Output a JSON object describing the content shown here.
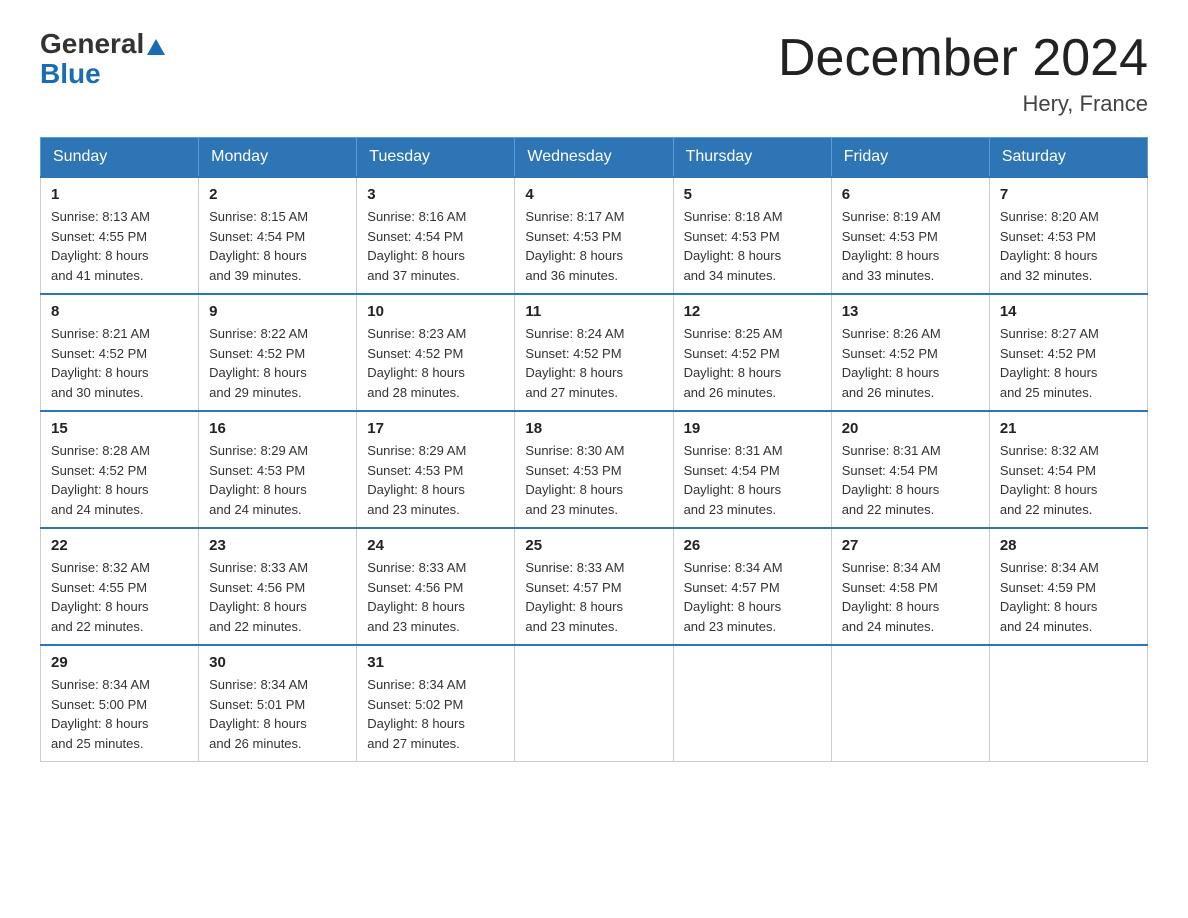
{
  "header": {
    "logo_line1": "General",
    "logo_line2": "Blue",
    "month_title": "December 2024",
    "location": "Hery, France"
  },
  "weekdays": [
    "Sunday",
    "Monday",
    "Tuesday",
    "Wednesday",
    "Thursday",
    "Friday",
    "Saturday"
  ],
  "weeks": [
    [
      {
        "day": "1",
        "sunrise": "8:13 AM",
        "sunset": "4:55 PM",
        "daylight": "8 hours and 41 minutes."
      },
      {
        "day": "2",
        "sunrise": "8:15 AM",
        "sunset": "4:54 PM",
        "daylight": "8 hours and 39 minutes."
      },
      {
        "day": "3",
        "sunrise": "8:16 AM",
        "sunset": "4:54 PM",
        "daylight": "8 hours and 37 minutes."
      },
      {
        "day": "4",
        "sunrise": "8:17 AM",
        "sunset": "4:53 PM",
        "daylight": "8 hours and 36 minutes."
      },
      {
        "day": "5",
        "sunrise": "8:18 AM",
        "sunset": "4:53 PM",
        "daylight": "8 hours and 34 minutes."
      },
      {
        "day": "6",
        "sunrise": "8:19 AM",
        "sunset": "4:53 PM",
        "daylight": "8 hours and 33 minutes."
      },
      {
        "day": "7",
        "sunrise": "8:20 AM",
        "sunset": "4:53 PM",
        "daylight": "8 hours and 32 minutes."
      }
    ],
    [
      {
        "day": "8",
        "sunrise": "8:21 AM",
        "sunset": "4:52 PM",
        "daylight": "8 hours and 30 minutes."
      },
      {
        "day": "9",
        "sunrise": "8:22 AM",
        "sunset": "4:52 PM",
        "daylight": "8 hours and 29 minutes."
      },
      {
        "day": "10",
        "sunrise": "8:23 AM",
        "sunset": "4:52 PM",
        "daylight": "8 hours and 28 minutes."
      },
      {
        "day": "11",
        "sunrise": "8:24 AM",
        "sunset": "4:52 PM",
        "daylight": "8 hours and 27 minutes."
      },
      {
        "day": "12",
        "sunrise": "8:25 AM",
        "sunset": "4:52 PM",
        "daylight": "8 hours and 26 minutes."
      },
      {
        "day": "13",
        "sunrise": "8:26 AM",
        "sunset": "4:52 PM",
        "daylight": "8 hours and 26 minutes."
      },
      {
        "day": "14",
        "sunrise": "8:27 AM",
        "sunset": "4:52 PM",
        "daylight": "8 hours and 25 minutes."
      }
    ],
    [
      {
        "day": "15",
        "sunrise": "8:28 AM",
        "sunset": "4:52 PM",
        "daylight": "8 hours and 24 minutes."
      },
      {
        "day": "16",
        "sunrise": "8:29 AM",
        "sunset": "4:53 PM",
        "daylight": "8 hours and 24 minutes."
      },
      {
        "day": "17",
        "sunrise": "8:29 AM",
        "sunset": "4:53 PM",
        "daylight": "8 hours and 23 minutes."
      },
      {
        "day": "18",
        "sunrise": "8:30 AM",
        "sunset": "4:53 PM",
        "daylight": "8 hours and 23 minutes."
      },
      {
        "day": "19",
        "sunrise": "8:31 AM",
        "sunset": "4:54 PM",
        "daylight": "8 hours and 23 minutes."
      },
      {
        "day": "20",
        "sunrise": "8:31 AM",
        "sunset": "4:54 PM",
        "daylight": "8 hours and 22 minutes."
      },
      {
        "day": "21",
        "sunrise": "8:32 AM",
        "sunset": "4:54 PM",
        "daylight": "8 hours and 22 minutes."
      }
    ],
    [
      {
        "day": "22",
        "sunrise": "8:32 AM",
        "sunset": "4:55 PM",
        "daylight": "8 hours and 22 minutes."
      },
      {
        "day": "23",
        "sunrise": "8:33 AM",
        "sunset": "4:56 PM",
        "daylight": "8 hours and 22 minutes."
      },
      {
        "day": "24",
        "sunrise": "8:33 AM",
        "sunset": "4:56 PM",
        "daylight": "8 hours and 23 minutes."
      },
      {
        "day": "25",
        "sunrise": "8:33 AM",
        "sunset": "4:57 PM",
        "daylight": "8 hours and 23 minutes."
      },
      {
        "day": "26",
        "sunrise": "8:34 AM",
        "sunset": "4:57 PM",
        "daylight": "8 hours and 23 minutes."
      },
      {
        "day": "27",
        "sunrise": "8:34 AM",
        "sunset": "4:58 PM",
        "daylight": "8 hours and 24 minutes."
      },
      {
        "day": "28",
        "sunrise": "8:34 AM",
        "sunset": "4:59 PM",
        "daylight": "8 hours and 24 minutes."
      }
    ],
    [
      {
        "day": "29",
        "sunrise": "8:34 AM",
        "sunset": "5:00 PM",
        "daylight": "8 hours and 25 minutes."
      },
      {
        "day": "30",
        "sunrise": "8:34 AM",
        "sunset": "5:01 PM",
        "daylight": "8 hours and 26 minutes."
      },
      {
        "day": "31",
        "sunrise": "8:34 AM",
        "sunset": "5:02 PM",
        "daylight": "8 hours and 27 minutes."
      },
      null,
      null,
      null,
      null
    ]
  ],
  "labels": {
    "sunrise": "Sunrise:",
    "sunset": "Sunset:",
    "daylight": "Daylight:"
  }
}
